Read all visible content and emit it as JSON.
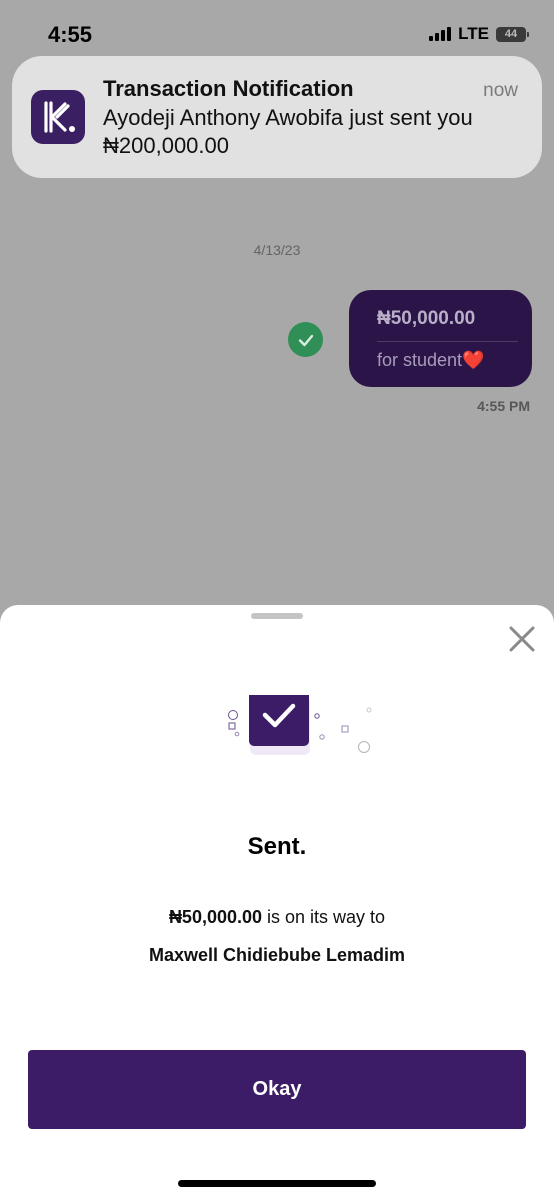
{
  "status_bar": {
    "time": "4:55",
    "network": "LTE",
    "battery": "44"
  },
  "notification": {
    "title": "Transaction Notification",
    "time": "now",
    "body": "Ayodeji Anthony Awobifa just sent you ₦200,000.00",
    "app_icon": "kuda-logo-icon"
  },
  "chat": {
    "date": "4/13/23",
    "message": {
      "amount": "₦50,000.00",
      "note": "for student",
      "emoji": "❤️",
      "time": "4:55 PM"
    }
  },
  "sheet": {
    "title": "Sent.",
    "amount": "₦50,000.00",
    "message_suffix": " is on its way to",
    "recipient": "Maxwell Chidiebube Lemadim",
    "button_label": "Okay"
  },
  "colors": {
    "brand": "#3d1c67",
    "bubble": "#2b1447",
    "success": "#2f8f56"
  }
}
